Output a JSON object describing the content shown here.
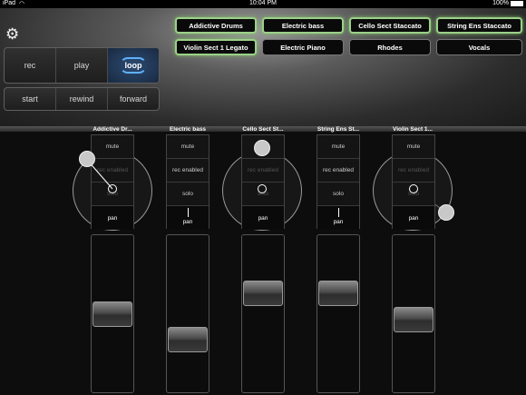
{
  "status": {
    "device": "iPad",
    "time": "10:04 PM",
    "battery": "100%"
  },
  "transport": {
    "row1": [
      {
        "label": "rec"
      },
      {
        "label": "play"
      },
      {
        "label": "loop",
        "active": true
      }
    ],
    "row2": [
      {
        "label": "start"
      },
      {
        "label": "rewind"
      },
      {
        "label": "forward"
      }
    ]
  },
  "tracks": [
    {
      "label": "Addictive Drums",
      "selected": true
    },
    {
      "label": "Electric bass",
      "selected": true
    },
    {
      "label": "Cello Sect Staccato",
      "selected": true
    },
    {
      "label": "String Ens Staccato",
      "selected": true
    },
    {
      "label": "Violin Sect 1 Legato",
      "selected": true
    },
    {
      "label": "Electric Piano",
      "selected": false
    },
    {
      "label": "Rhodes",
      "selected": false
    },
    {
      "label": "Vocals",
      "selected": false
    }
  ],
  "channels": [
    {
      "title": "Addictive Dr...",
      "mute": "mute",
      "rec": "rec enabled",
      "solo": "solo",
      "pan": "pan",
      "fader_level": 0.5
    },
    {
      "title": "Electric bass",
      "mute": "mute",
      "rec": "rec enabled",
      "solo": "solo",
      "pan": "pan",
      "fader_level": 0.29
    },
    {
      "title": "Cello Sect St...",
      "mute": "mute",
      "rec": "rec enabled",
      "solo": "solo",
      "pan": "pan",
      "fader_level": 0.65
    },
    {
      "title": "String Ens St...",
      "mute": "mute",
      "rec": "rec enabled",
      "solo": "solo",
      "pan": "pan",
      "fader_level": 0.65
    },
    {
      "title": "Violin Sect 1...",
      "mute": "mute",
      "rec": "rec enabled",
      "solo": "solo",
      "pan": "pan",
      "fader_level": 0.46
    }
  ],
  "colors": {
    "accent": "#5fb0ff",
    "selected_border": "#9bd08a"
  }
}
